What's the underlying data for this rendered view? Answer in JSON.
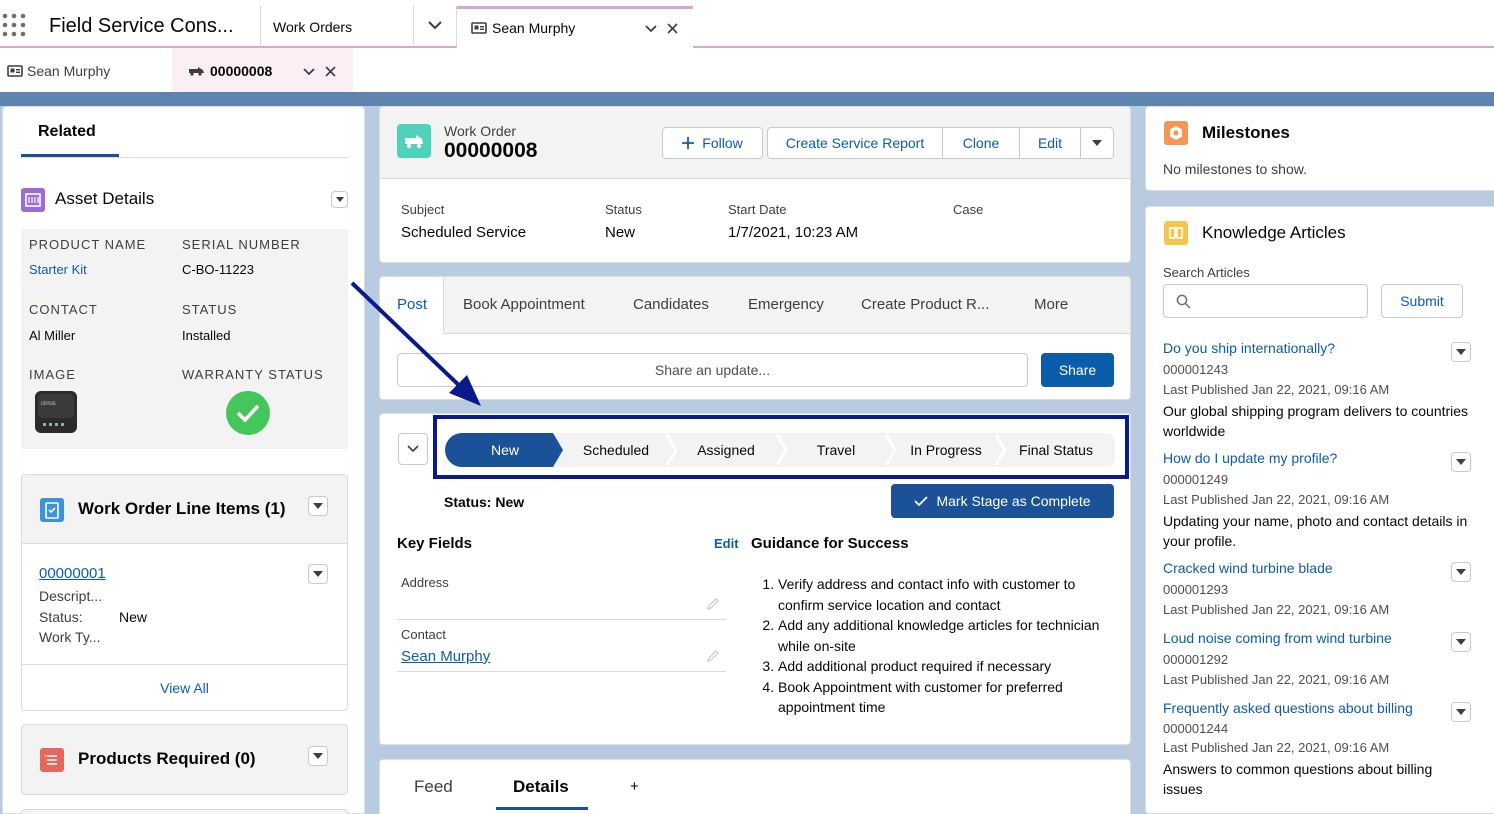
{
  "nav": {
    "app_name": "Field Service Cons...",
    "tabs": [
      {
        "label": "Work Orders"
      },
      {
        "label": "Sean Murphy"
      }
    ]
  },
  "subtabs": [
    {
      "label": "Sean Murphy"
    },
    {
      "label": "00000008"
    }
  ],
  "related": {
    "tab_label": "Related",
    "asset": {
      "title": "Asset Details",
      "product_name_label": "PRODUCT NAME",
      "product_name": "Starter Kit",
      "serial_label": "SERIAL NUMBER",
      "serial": "C-BO-11223",
      "contact_label": "CONTACT",
      "contact": "Al Miller",
      "status_label": "STATUS",
      "status": "Installed",
      "image_label": "IMAGE",
      "warranty_label": "WARRANTY STATUS"
    },
    "line_items": {
      "title": "Work Order Line Items (1)",
      "item_number": "00000001",
      "desc": "Descript...",
      "status_label": "Status:",
      "status_value": "New",
      "work_type": "Work Ty...",
      "view_all": "View All"
    },
    "products": {
      "title": "Products Required (0)"
    }
  },
  "header": {
    "object_label": "Work Order",
    "record_number": "00000008",
    "follow": "Follow",
    "create_report": "Create Service Report",
    "clone": "Clone",
    "edit": "Edit",
    "fields": [
      {
        "label": "Subject",
        "value": "Scheduled Service"
      },
      {
        "label": "Status",
        "value": "New"
      },
      {
        "label": "Start Date",
        "value": "1/7/2021, 10:23 AM"
      },
      {
        "label": "Case",
        "value": ""
      }
    ]
  },
  "publisher": {
    "tabs": [
      "Post",
      "Book Appointment",
      "Candidates",
      "Emergency",
      "Create Product R...",
      "More"
    ],
    "placeholder": "Share an update...",
    "share": "Share"
  },
  "path": {
    "stages": [
      "New",
      "Scheduled",
      "Assigned",
      "Travel",
      "In Progress",
      "Final Status"
    ],
    "current_index": 0,
    "status_text": "Status: New",
    "mark_complete": "Mark Stage as Complete",
    "key_fields_title": "Key Fields",
    "edit": "Edit",
    "address_label": "Address",
    "contact_label": "Contact",
    "contact_value": "Sean Murphy",
    "guidance_title": "Guidance for Success",
    "guidance": [
      "Verify address and contact info with customer to confirm service location and contact",
      "Add any additional knowledge articles for technician while on-site",
      "Add additional product required if necessary",
      "Book Appointment with customer for preferred appointment time"
    ]
  },
  "feed_tabs": [
    "Feed",
    "Details",
    "+"
  ],
  "milestones": {
    "title": "Milestones",
    "empty": "No milestones to show."
  },
  "knowledge": {
    "title": "Knowledge Articles",
    "search_label": "Search Articles",
    "submit": "Submit",
    "articles": [
      {
        "title": "Do you ship internationally?",
        "number": "000001243",
        "published": "Last Published Jan 22, 2021, 09:16 AM",
        "summary": "Our global shipping program delivers to countries worldwide"
      },
      {
        "title": "How do I update my profile?",
        "number": "000001249",
        "published": "Last Published Jan 22, 2021, 09:16 AM",
        "summary": "Updating your name, photo and contact details in your profile."
      },
      {
        "title": "Cracked wind turbine blade",
        "number": "000001293",
        "published": "Last Published Jan 22, 2021, 09:16 AM",
        "summary": ""
      },
      {
        "title": "Loud noise coming from wind turbine",
        "number": "000001292",
        "published": "Last Published Jan 22, 2021, 09:16 AM",
        "summary": ""
      },
      {
        "title": "Frequently asked questions about billing",
        "number": "000001244",
        "published": "Last Published Jan 22, 2021, 09:16 AM",
        "summary": "Answers to common questions about billing issues"
      }
    ]
  },
  "colors": {
    "brand": "#0b5cab",
    "path_active": "#1b5297",
    "highlight_box": "#0a1a8c",
    "warranty_ok": "#45c65a"
  }
}
